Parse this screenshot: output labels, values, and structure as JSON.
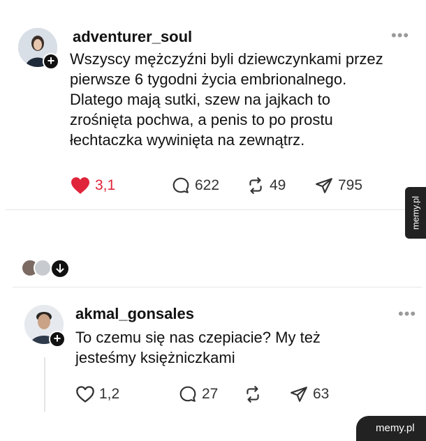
{
  "post1": {
    "username": "adventurer_soul",
    "more": "•••",
    "text": "Wszyscy mężczyźni byli dziewczynkami przez\npierwsze 6 tygodni życia embrionalnego.\nDlatego mają sutki, szew na jajkach to\nzrośnięta pochwa, a penis to po prostu\nłechtaczka wywinięta na zewnątrz.",
    "likes": "3,1",
    "comments": "622",
    "reposts": "49",
    "shares": "795",
    "liked": true
  },
  "reply": {
    "username": "akmal_gonsales",
    "more": "•••",
    "text": "To czemu się nas czepiacie? My też\njesteśmy  księżniczkami",
    "likes": "1,2",
    "comments": "27",
    "shares": "63",
    "liked": false
  },
  "watermark": {
    "side": "memy.pl",
    "corner": "memy.pl"
  },
  "colors": {
    "like_active": "#e0243a",
    "text": "#111111",
    "muted": "#9a9a9a"
  },
  "icons": [
    "plus-icon",
    "heart-icon",
    "comment-icon",
    "repost-icon",
    "send-icon",
    "more-icon",
    "arrow-down-icon"
  ]
}
